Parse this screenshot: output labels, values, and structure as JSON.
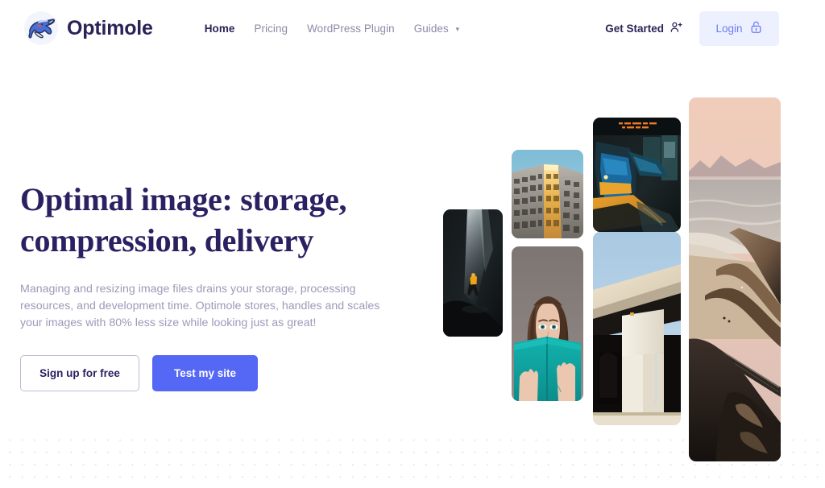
{
  "brand": {
    "name": "Optimole",
    "logo_icon": "mole-mascot-logo",
    "logo_colors": {
      "body": "#4a6fd4",
      "belly": "#f3e2c7",
      "accent": "#e8533f"
    }
  },
  "nav": {
    "items": [
      {
        "label": "Home",
        "active": true,
        "has_dropdown": false
      },
      {
        "label": "Pricing",
        "active": false,
        "has_dropdown": false
      },
      {
        "label": "WordPress Plugin",
        "active": false,
        "has_dropdown": false
      },
      {
        "label": "Guides",
        "active": false,
        "has_dropdown": true,
        "caret_icon": "chevron-down-icon"
      }
    ]
  },
  "header_actions": {
    "get_started": {
      "label": "Get Started",
      "icon": "user-plus-icon"
    },
    "login": {
      "label": "Login",
      "icon": "unlock-icon"
    }
  },
  "hero": {
    "title_line1": "Optimal image: storage,",
    "title_line2": "compression, delivery",
    "subtitle": "Managing and resizing image files drains your storage, processing resources, and development time. Optimole stores, handles and scales your images with 80% less size while looking just as great!",
    "primary_button": "Test my site",
    "secondary_button": "Sign up for free"
  },
  "collage": {
    "images": [
      {
        "id": "img-cave",
        "alt": "person in yellow jacket walking through a dark cave"
      },
      {
        "id": "img-building",
        "alt": "upward view of a building facade lit by golden sunlight"
      },
      {
        "id": "img-reader",
        "alt": "young woman hiding her face behind a teal book"
      },
      {
        "id": "img-train",
        "alt": "blue and yellow train at a station platform at night"
      },
      {
        "id": "img-arch",
        "alt": "modern concrete architecture against a blue sky"
      },
      {
        "id": "img-coast",
        "alt": "coastal cliffs and ocean at sunset with a road"
      }
    ]
  },
  "theme": {
    "brand_navy": "#2b2356",
    "heading_navy": "#2b2162",
    "accent_blue": "#5468f5",
    "login_bg": "#edf0fe",
    "login_text": "#6b7cf6",
    "muted_text": "#9d9ab8",
    "nav_text": "#8e8aa8",
    "dot_grid": "#e9e9ee"
  }
}
